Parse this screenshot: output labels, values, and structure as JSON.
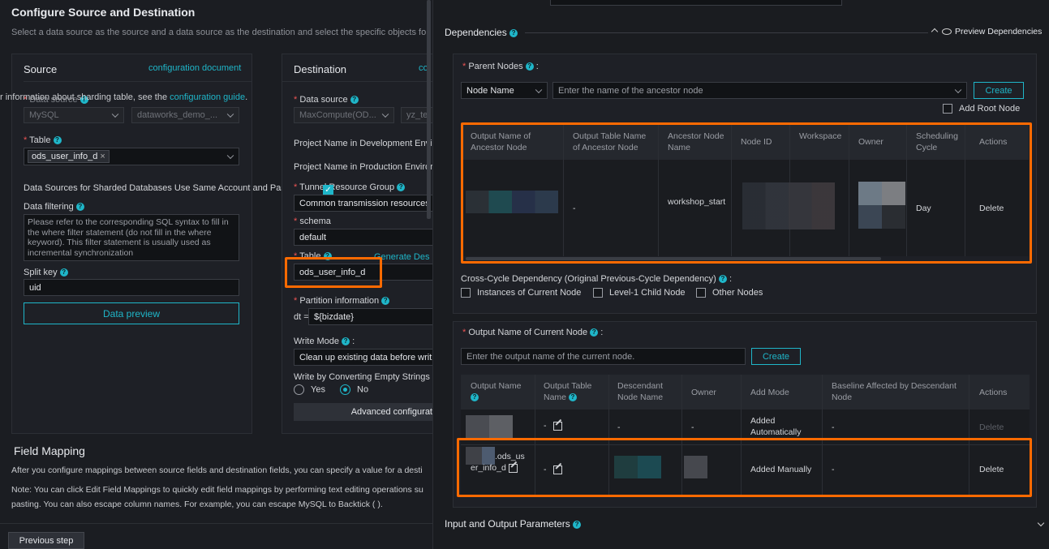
{
  "left": {
    "title": "Configure Source and Destination",
    "desc": "Select a data source as the source and a data source as the destination and select the specific objects for dat",
    "source": {
      "heading": "Source",
      "doc_link": "configuration document",
      "sharding_note_prefix": "r information about sharding table, see the ",
      "sharding_note_link": "configuration guide",
      "sharding_note_suffix": ".",
      "datasource_label": "Data source",
      "ds_type": "MySQL",
      "ds_name": "dataworks_demo_...",
      "table_label": "Table",
      "table_tag": "ods_user_info_d",
      "sharded_label": "Data Sources for Sharded Databases Use Same Account and Passw",
      "filter_label": "Data filtering",
      "filter_placeholder": "Please refer to the corresponding SQL syntax to fill in the where filter statement (do not fill in the where keyword). This filter statement is usually used as incremental synchronization",
      "split_label": "Split key",
      "split_value": "uid",
      "preview_button": "Data preview"
    },
    "dest": {
      "heading": "Destination",
      "doc_link": "co",
      "datasource_label": "Data source",
      "ds_type": "MaxCompute(OD...",
      "ds_name": "yz_te",
      "proj_dev": "Project Name in Development Envir",
      "proj_prod": "Project Name in Production Enviror",
      "tunnel_label": "Tunnel Resource Group",
      "tunnel_value": "Common transmission resources",
      "schema_label": "schema",
      "schema_value": "default",
      "table_label": "Table",
      "generate_link": "Generate Des",
      "table_value": "ods_user_info_d",
      "partition_label": "Partition information",
      "partition_key": "dt =",
      "partition_value": "${bizdate}",
      "write_mode_label": "Write Mode",
      "write_mode_value": "Clean up existing data before writ",
      "empty_strings_label": "Write by Converting Empty Strings",
      "yes": "Yes",
      "no": "No",
      "advanced": "Advanced configurat"
    },
    "field_mapping": {
      "title": "Field Mapping",
      "desc1": "After you configure mappings between source fields and destination fields, you can specify a value for a desti",
      "desc2": "Note: You can click Edit Field Mappings to quickly edit field mappings by performing text editing operations su",
      "desc3": "pasting. You can also escape column names. For example, you can escape MySQL to Backtick ( )."
    },
    "prev_button": "Previous step"
  },
  "right": {
    "title": "Dependencies",
    "preview_dep": "Preview Dependencies",
    "parent": {
      "label": "Parent Nodes",
      "select": "Node Name",
      "placeholder": "Enter the name of the ancestor node",
      "create": "Create",
      "add_root": "Add Root Node",
      "headers": [
        "Output Name of Ancestor Node",
        "Output Table Name of Ancestor Node",
        "Ancestor Node Name",
        "Node ID",
        "Workspace",
        "Owner",
        "Scheduling Cycle",
        "Actions"
      ],
      "row": {
        "table": "-",
        "node_name": "workshop_start",
        "cycle": "Day",
        "action": "Delete"
      }
    },
    "cross": {
      "label": "Cross-Cycle Dependency (Original Previous-Cycle Dependency)",
      "opt1": "Instances of Current Node",
      "opt2": "Level-1 Child Node",
      "opt3": "Other Nodes"
    },
    "output": {
      "label": "Output Name of Current Node",
      "placeholder": "Enter the output name of the current node.",
      "create": "Create",
      "headers": [
        "Output Name",
        "Output Table Name",
        "Descendant Node Name",
        "Owner",
        "Add Mode",
        "Baseline Affected by Descendant Node",
        "Actions"
      ],
      "row1": {
        "table": "-",
        "desc": "-",
        "owner": "-",
        "mode": "Added Automatically",
        "baseline": "-",
        "action": "Delete"
      },
      "row2": {
        "name": ".ods_user_info_d",
        "table": "-",
        "mode": "Added Manually",
        "baseline": "-",
        "action": "Delete"
      }
    },
    "io_params": "Input and Output Parameters"
  },
  "colors": {
    "accent": "#1fb6c9",
    "highlight": "#ff6a00",
    "required": "#ee5555"
  }
}
